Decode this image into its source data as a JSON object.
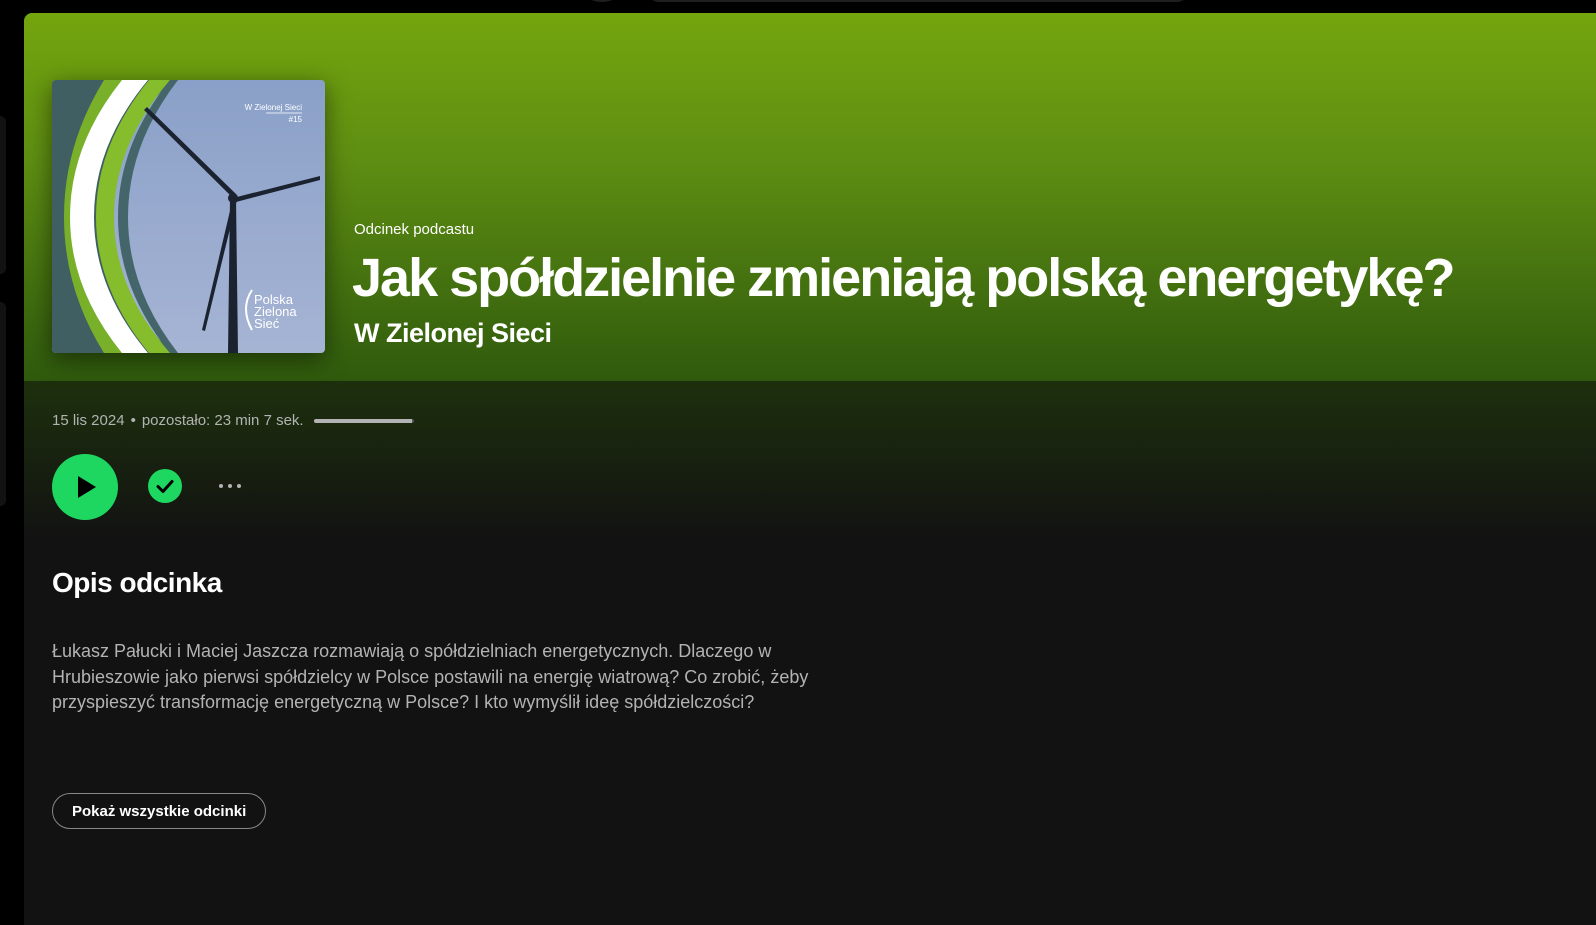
{
  "episode": {
    "type_label": "Odcinek podcastu",
    "title": "Jak spółdzielnie zmieniają polską energetykę?",
    "show_name": "W Zielonej Sieci",
    "date": "15 lis 2024",
    "separator": "•",
    "remaining": "pozostało: 23 min 7 sek.",
    "progress_fraction": 0.98
  },
  "cover": {
    "series_title": "W Zielonej Sieci",
    "episode_number": "#15",
    "logo_lines": [
      "Polska",
      "Zielona",
      "Sieć"
    ]
  },
  "controls": {
    "play_icon": "play-icon",
    "saved_icon": "check-icon",
    "more_icon": "more-options-icon"
  },
  "description": {
    "heading": "Opis odcinka",
    "text": "Łukasz Pałucki i Maciej Jaszcza rozmawiają o spółdzielniach energetycznych. Dlaczego w Hrubieszowie jako pierwsi spółdzielcy w Polsce postawili na energię wiatrową? Co zrobić, żeby przyspieszyć transformację energetyczną w Polsce? I kto wymyślił ideę spółdzielczości?"
  },
  "show_all_label": "Pokaż wszystkie odcinki",
  "colors": {
    "accent": "#1ed760",
    "hero_top": "#74a50e",
    "hero_bottom": "#2f5a0d",
    "background": "#121212"
  }
}
